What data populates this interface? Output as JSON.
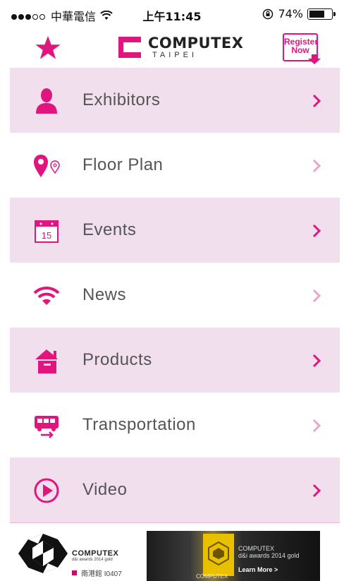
{
  "status_bar": {
    "carrier": "中華電信",
    "time": "上午11:45",
    "battery": "74%",
    "battery_level": 0.74
  },
  "header": {
    "logo_main": "COMPUTEX",
    "logo_sub": "TAIPEI",
    "register_line1": "Register",
    "register_line2": "Now"
  },
  "menu": {
    "items": [
      {
        "label": "Exhibitors",
        "icon": "person-icon"
      },
      {
        "label": "Floor Plan",
        "icon": "map-pin-icon"
      },
      {
        "label": "Events",
        "icon": "calendar-icon",
        "calendar_day": "15"
      },
      {
        "label": "News",
        "icon": "wifi-icon"
      },
      {
        "label": "Products",
        "icon": "box-icon"
      },
      {
        "label": "Transportation",
        "icon": "bus-icon"
      },
      {
        "label": "Video",
        "icon": "play-icon"
      }
    ]
  },
  "footer": {
    "sponsor_name": "COMPUTEX",
    "sponsor_award": "d&i awards 2014 gold",
    "sponsor_booth": "南港館 I0407",
    "banner_line1": "COMPUTEX",
    "banner_line2": "d&i awards 2014 gold",
    "banner_cta": "Learn More >",
    "banner_watermark": "COMPUTEX"
  },
  "colors": {
    "accent": "#e0157e",
    "row_shade": "#f2dfee",
    "chevron_dim": "#e9a6c8"
  }
}
